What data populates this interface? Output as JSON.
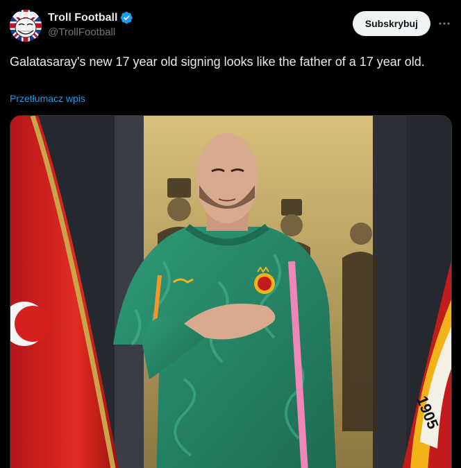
{
  "author": {
    "display_name": "Troll Football",
    "handle": "@TrollFootball",
    "avatar_icon": "troll-face-avatar",
    "verified_icon": "verified-badge-icon"
  },
  "actions": {
    "subscribe_label": "Subskrybuj",
    "more_icon": "more-options-icon"
  },
  "tweet": {
    "text": "Galatasaray's new 17 year old signing looks like the father of a 17 year old.",
    "translate_link": "Przetłumacz wpis"
  },
  "media": {
    "flag_text": "1905"
  },
  "colors": {
    "background": "#000000",
    "text": "#e7e9ea",
    "secondary": "#71767b",
    "link": "#1d9bf0",
    "verified": "#1d9bf0",
    "jersey": "#2a8a6a"
  }
}
